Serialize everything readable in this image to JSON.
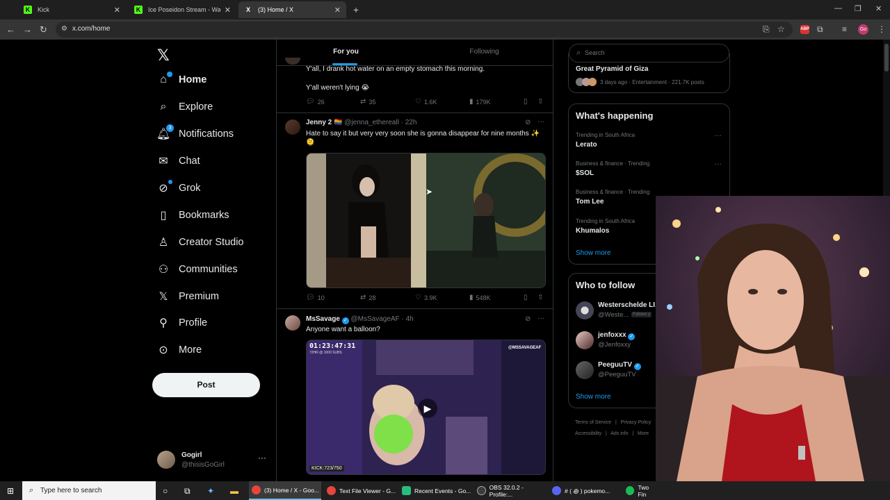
{
  "browser": {
    "tabs": [
      {
        "title": "Kick",
        "favicon": "K",
        "favicon_color": "#53fc18"
      },
      {
        "title": "Ice Poseidon Stream - Watch Li",
        "favicon": "K",
        "favicon_color": "#53fc18"
      },
      {
        "title": "(3) Home / X",
        "favicon": "X",
        "favicon_color": "#ffffff"
      }
    ],
    "url": "x.com/home",
    "profile_initials": "Go",
    "extension_label": "ABP"
  },
  "nav": {
    "items": [
      {
        "label": "Home",
        "icon": "home-icon"
      },
      {
        "label": "Explore",
        "icon": "search-icon"
      },
      {
        "label": "Notifications",
        "icon": "bell-icon",
        "badge": "3"
      },
      {
        "label": "Chat",
        "icon": "mail-icon"
      },
      {
        "label": "Grok",
        "icon": "grok-icon"
      },
      {
        "label": "Bookmarks",
        "icon": "bookmark-icon"
      },
      {
        "label": "Creator Studio",
        "icon": "creator-icon"
      },
      {
        "label": "Communities",
        "icon": "communities-icon"
      },
      {
        "label": "Premium",
        "icon": "x-icon"
      },
      {
        "label": "Profile",
        "icon": "profile-icon"
      },
      {
        "label": "More",
        "icon": "more-icon"
      }
    ],
    "post_label": "Post",
    "account": {
      "name": "Gogirl",
      "handle": "@thisisGoGirl"
    }
  },
  "feed": {
    "tabs": [
      "For you",
      "Following"
    ],
    "tweet1": {
      "line1": "Y'all, I drank hot water on an empty stomach this morning.",
      "line2": "Y'all weren't lying 😭",
      "replies": "26",
      "reposts": "35",
      "likes": "1.6K",
      "views": "179K"
    },
    "tweet2": {
      "name": "Jenny 2 🏳️‍🌈",
      "handle": "@jenna_ethereall",
      "time": "22h",
      "text": "Hate to say it but very very soon she is gonna disappear for nine months ✨🫠",
      "replies": "10",
      "reposts": "28",
      "likes": "3.9K",
      "views": "548K"
    },
    "tweet3": {
      "name": "MsSavage",
      "handle": "@MsSavageAF",
      "time": "4h",
      "text": "Anyone want a balloon?",
      "video_timer": "01:23:47:31",
      "video_sub": "72HR @ 1000 SUBS",
      "video_tag": "@MSSAVAGEAF",
      "video_kick": "KICK:723/750"
    }
  },
  "right": {
    "search_placeholder": "Search",
    "top_trend": {
      "name": "Great Pyramid of Giza",
      "meta": "3 days ago · Entertainment · 221.7K posts"
    },
    "happening_title": "What's happening",
    "trends": [
      {
        "context": "Trending in South Africa",
        "name": "Lerato"
      },
      {
        "context": "Business & finance · Trending",
        "name": "$SOL"
      },
      {
        "context": "Business & finance · Trending",
        "name": "Tom Lee"
      },
      {
        "context": "Trending in South Africa",
        "name": "Khumalos"
      }
    ],
    "show_more": "Show more",
    "wtf_title": "Who to follow",
    "follow": [
      {
        "name": "Westerschelde LI...",
        "handle": "@Weste...",
        "tag": "Follows y"
      },
      {
        "name": "jenfoxxx",
        "handle": "@Jenfoxxy"
      },
      {
        "name": "PeeguuTV",
        "handle": "@PeeguuTV"
      }
    ],
    "footer": [
      "Terms of Service",
      "Privacy Policy",
      "Accessibility",
      "Ads info",
      "More"
    ]
  },
  "taskbar": {
    "search_placeholder": "Type here to search",
    "apps": [
      {
        "label": "(3) Home / X - Goo...",
        "color": "#e8453c"
      },
      {
        "label": "Text File Viewer - G...",
        "color": "#e8453c"
      },
      {
        "label": "Recent Events - Go...",
        "color": "#2bbd7e"
      },
      {
        "label": "OBS 32.0.2 - Profile:...",
        "color": "#3c3c3c"
      },
      {
        "label": "# ( ꩜ ) pokemo...",
        "color": "#5865f2"
      },
      {
        "label": "Two Fin",
        "color": "#1db954"
      }
    ]
  }
}
